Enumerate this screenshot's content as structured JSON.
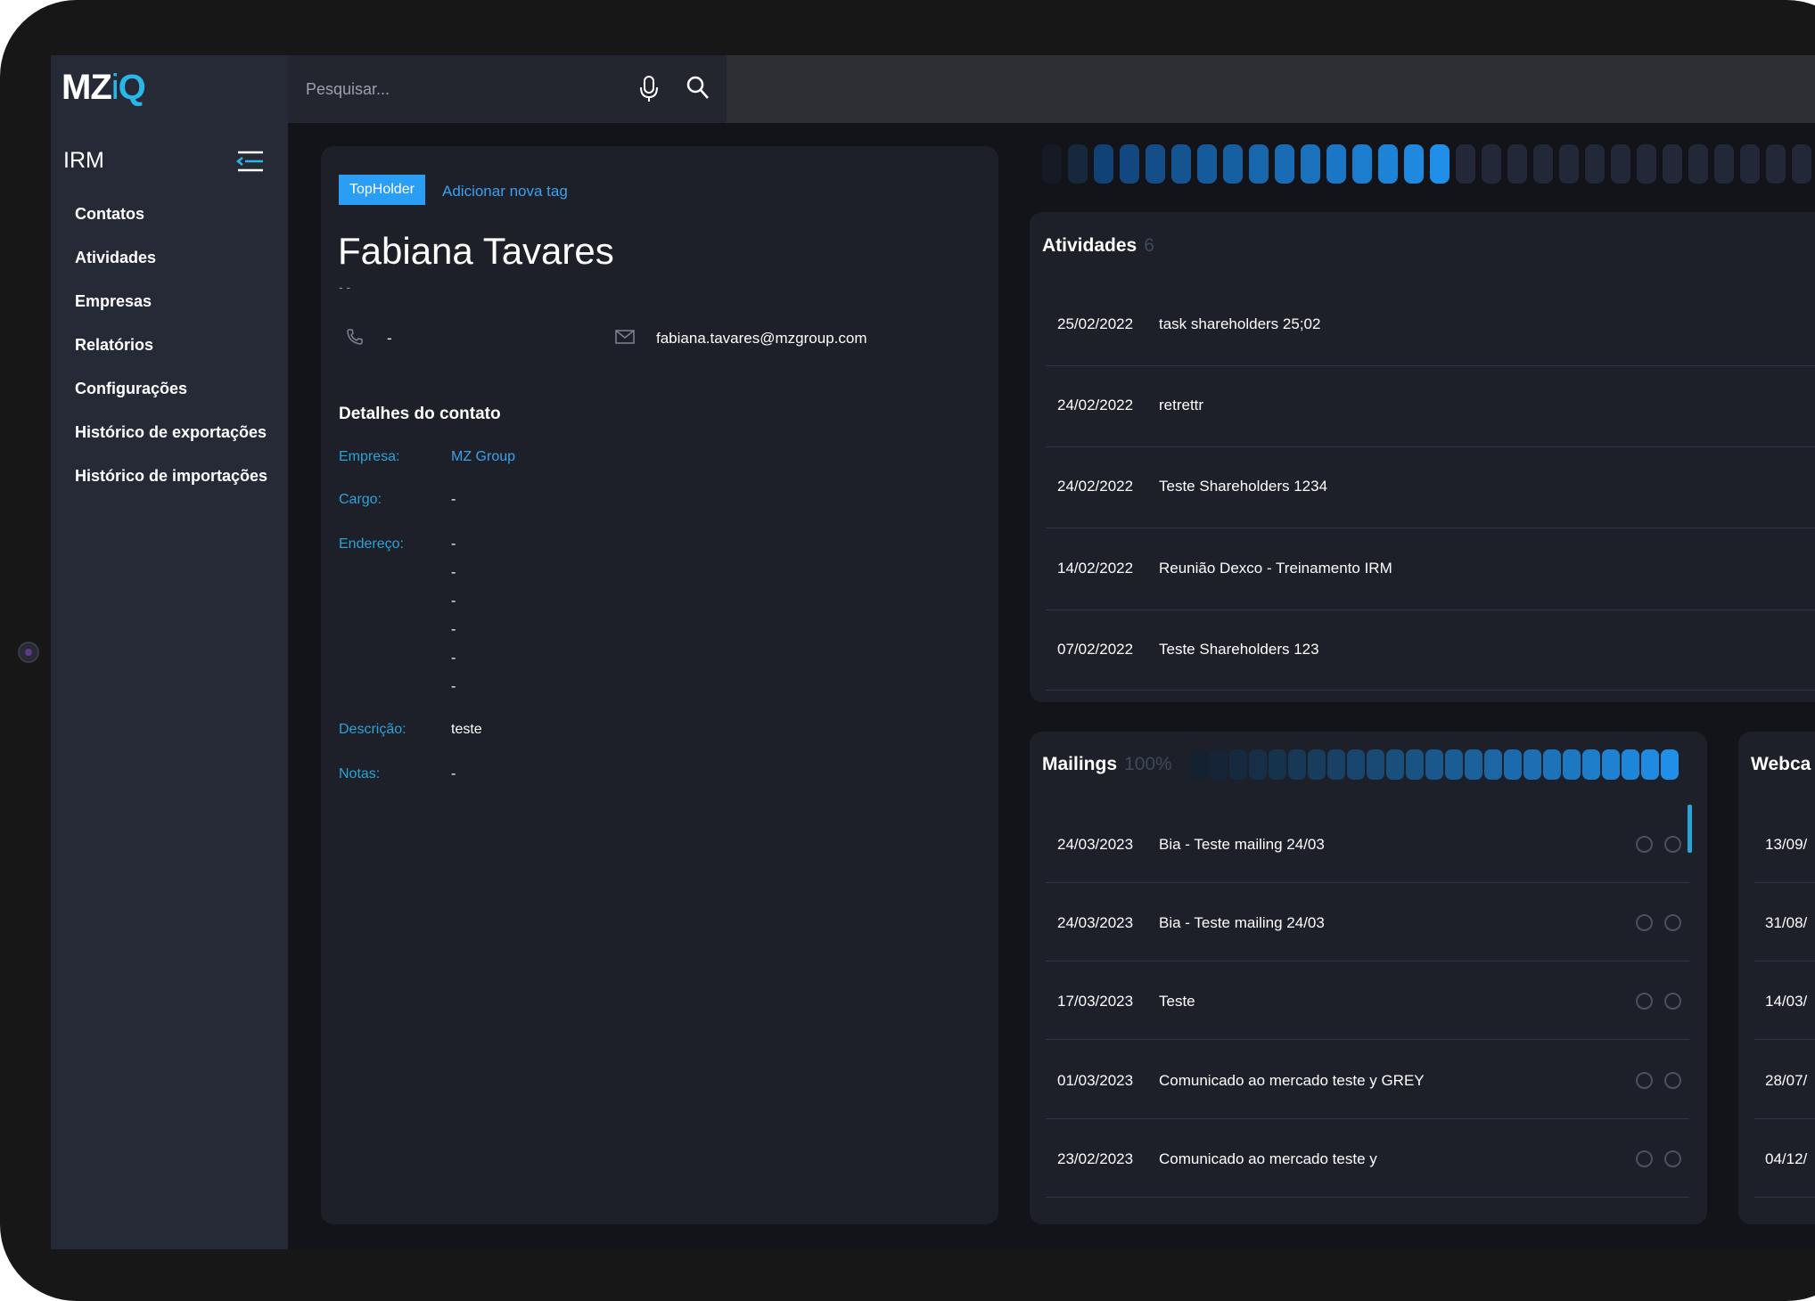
{
  "brand": {
    "logo": "MZiQ"
  },
  "sidebar": {
    "title": "IRM",
    "items": [
      {
        "label": "Contatos"
      },
      {
        "label": "Atividades"
      },
      {
        "label": "Empresas"
      },
      {
        "label": "Relatórios"
      },
      {
        "label": "Configurações"
      },
      {
        "label": "Histórico de exportações"
      },
      {
        "label": "Histórico de importações"
      }
    ]
  },
  "search": {
    "placeholder": "Pesquisar..."
  },
  "contact": {
    "tag": "TopHolder",
    "add_tag": "Adicionar nova tag",
    "name": "Fabiana Tavares",
    "subtitle": "- -",
    "phone": "-",
    "email": "fabiana.tavares@mzgroup.com",
    "details_title": "Detalhes do contato",
    "company_label": "Empresa:",
    "company": "MZ Group",
    "role_label": "Cargo:",
    "role": "-",
    "address_label": "Endereço:",
    "address_lines": [
      "-",
      "-",
      "-",
      "-",
      "-",
      "-"
    ],
    "description_label": "Descrição:",
    "description": "teste",
    "notes_label": "Notas:",
    "notes": "-"
  },
  "engagement_bar": {
    "active_segments": 14,
    "total_segments": 31,
    "active_color": "#1f8fe8",
    "inactive_color": "#232838"
  },
  "activities": {
    "title": "Atividades",
    "count": "6",
    "rows": [
      {
        "date": "25/02/2022",
        "text": "task shareholders 25;02"
      },
      {
        "date": "24/02/2022",
        "text": "retrettr"
      },
      {
        "date": "24/02/2022",
        "text": "Teste Shareholders 1234"
      },
      {
        "date": "14/02/2022",
        "text": "Reunião Dexco - Treinamento IRM"
      },
      {
        "date": "07/02/2022",
        "text": "Teste Shareholders 123"
      }
    ]
  },
  "mailings": {
    "title": "Mailings",
    "percent": "100%",
    "rows": [
      {
        "date": "24/03/2023",
        "text": "Bia - Teste mailing 24/03"
      },
      {
        "date": "24/03/2023",
        "text": "Bia - Teste mailing 24/03"
      },
      {
        "date": "17/03/2023",
        "text": "Teste"
      },
      {
        "date": "01/03/2023",
        "text": "Comunicado ao mercado teste y GREY"
      },
      {
        "date": "23/02/2023",
        "text": "Comunicado ao mercado teste y"
      }
    ]
  },
  "webcasts": {
    "title": "Webca",
    "rows": [
      {
        "date": "13/09/"
      },
      {
        "date": "31/08/"
      },
      {
        "date": "14/03/"
      },
      {
        "date": "28/07/"
      },
      {
        "date": "04/12/"
      }
    ]
  }
}
